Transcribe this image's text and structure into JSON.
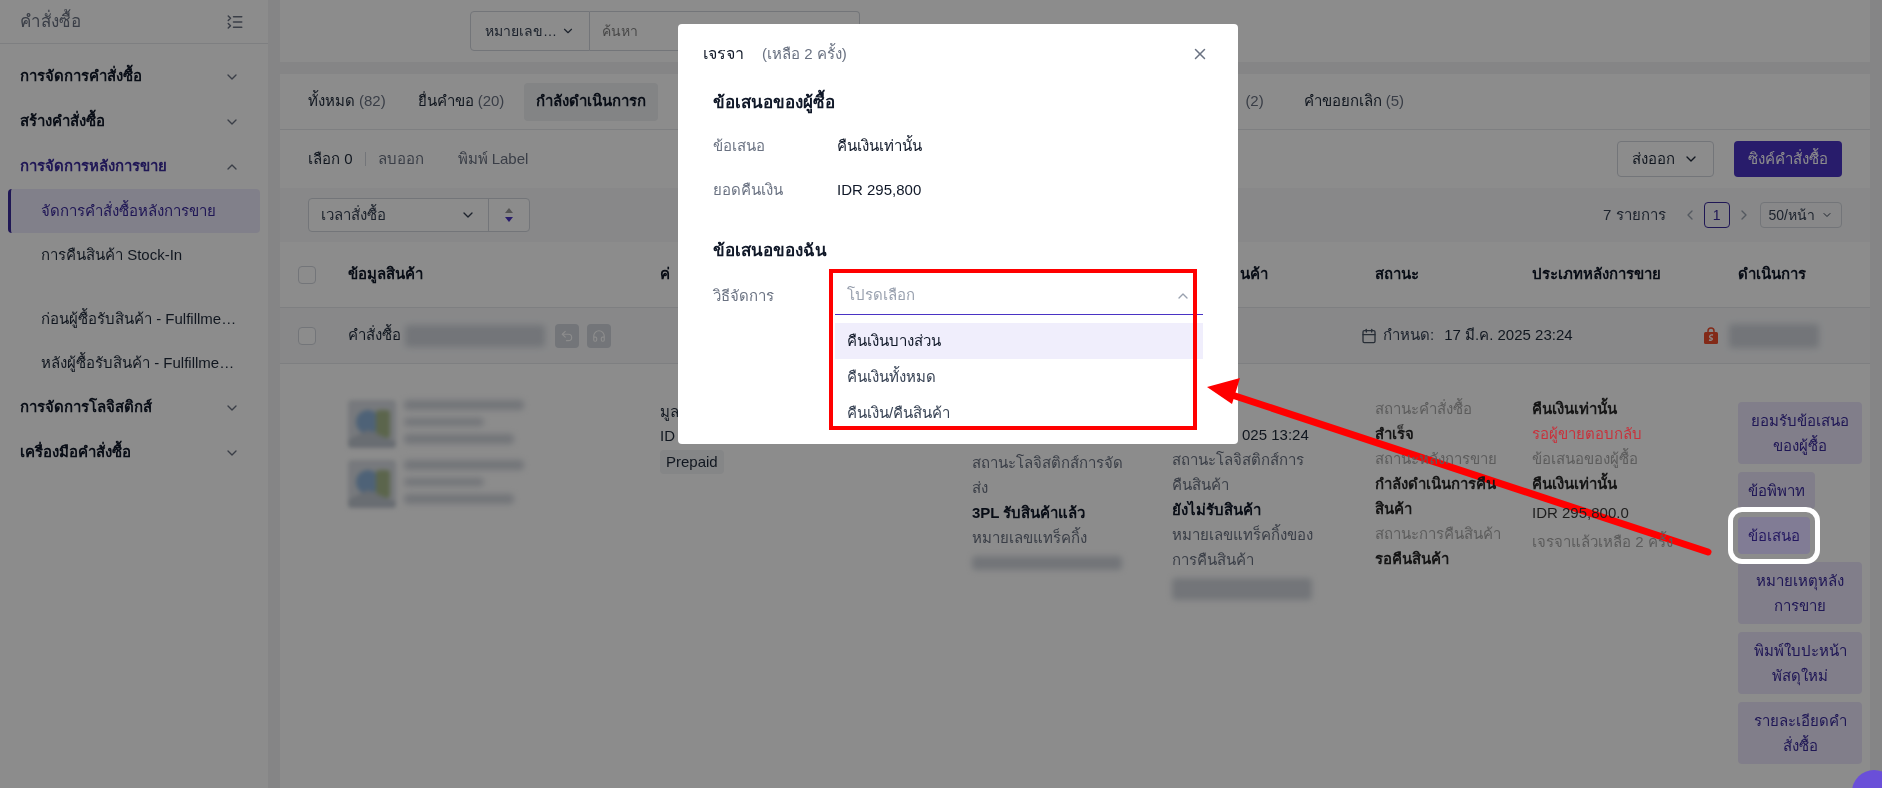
{
  "sidebar": {
    "title": "คำสั่งซื้อ",
    "items": [
      {
        "label": "การจัดการคำสั่งซื้อ",
        "expanded": false
      },
      {
        "label": "สร้างคำสั่งซื้อ",
        "expanded": false
      },
      {
        "label": "การจัดการหลังการขาย",
        "expanded": true,
        "children": [
          {
            "label": "จัดการคำสั่งซื้อหลังการขาย",
            "selected": true
          },
          {
            "label": "การคืนสินค้า Stock-In",
            "selected": false
          },
          {
            "label": "ก่อนผู้ซื้อรับสินค้า - Fulfillme…",
            "selected": false
          },
          {
            "label": "หลังผู้ซื้อรับสินค้า - Fulfillme…",
            "selected": false
          }
        ]
      },
      {
        "label": "การจัดการโลจิสติกส์",
        "expanded": false
      },
      {
        "label": "เครื่องมือคำสั่งซื้อ",
        "expanded": false
      }
    ]
  },
  "search": {
    "field": "หมายเลข…",
    "placeholder": "ค้นหา"
  },
  "tabs": [
    {
      "label": "ทั้งหมด",
      "count": "(82)",
      "selected": false
    },
    {
      "label": "ยื่นคำขอ",
      "count": "(20)",
      "selected": false
    },
    {
      "label": "กำลังดำเนินการก",
      "selected": true
    },
    {
      "count": "(2)",
      "selected": false
    },
    {
      "label": "คำขอยกเลิก",
      "count": "(5)",
      "selected": false
    }
  ],
  "toolbar": {
    "selection": "เลือก 0",
    "actions": [
      "ลบออก",
      "พิมพ์ Label"
    ],
    "export": "ส่งออก",
    "sync": "ซิงค์คำสั่งซื้อ"
  },
  "filter": {
    "sort_field": "เวลาสั่งซื้อ",
    "total": "7 รายการ",
    "page": "1",
    "page_size": "50/หน้า"
  },
  "table": {
    "select_all_checked": false,
    "columns": [
      "ข้อมูลสินค้า",
      "ค่",
      "นค้า",
      "สถานะ",
      "ประเภทหลังการขาย",
      "ดำเนินการ"
    ],
    "order": {
      "checked": false,
      "label": "คำสั่งซื้อ",
      "deadline_label": "กำหนด:",
      "deadline": "17 มี.ค. 2025 23:24"
    },
    "detail": {
      "payment_lines": [
        "มูล",
        "ID"
      ],
      "payment_tag": "Prepaid",
      "shipping": {
        "label": "สถานะโลจิสติกส์การจัดส่ง",
        "value": "3PL รับสินค้าแล้ว",
        "tracking_label": "หมายเลขแทร็คกิ้ง"
      },
      "return_shipping": {
        "time": "025 13:24",
        "label": "สถานะโลจิสติกส์การคืนสินค้า",
        "value": "ยังไม่รับสินค้า",
        "tracking_label": "หมายเลขแทร็คกิ้งของการคืนสินค้า"
      },
      "status": [
        {
          "label": "สถานะคำสั่งซื้อ",
          "value": "สำเร็จ"
        },
        {
          "label": "สถานะหลังการขาย",
          "value": "กำลังดำเนินการคืนสินค้า"
        },
        {
          "label": "สถานะการคืนสินค้า",
          "value": "รอคืนสินค้า"
        }
      ],
      "after_sales": {
        "type": "คืนเงินเท่านั้น",
        "state": "รอผู้ขายตอบกลับ",
        "offer_label": "ข้อเสนอของผู้ซื้อ",
        "offer": "คืนเงินเท่านั้น",
        "amount": "IDR 295,800.0",
        "remaining": "เจรจาแล้วเหลือ 2 ครั้ง"
      },
      "actions": [
        {
          "label": "ยอมรับข้อเสนอของผู้ซื้อ",
          "highlighted": false
        },
        {
          "label": "ข้อพิพาท",
          "highlighted": false
        },
        {
          "label": "ข้อเสนอ",
          "highlighted": true
        },
        {
          "label": "หมายเหตุหลังการขาย",
          "highlighted": false
        },
        {
          "label": "พิมพ์ใบปะหน้าพัสดุใหม่",
          "highlighted": false
        },
        {
          "label": "รายละเอียดคำสั่งซื้อ",
          "highlighted": false
        }
      ]
    }
  },
  "modal": {
    "title": "เจรจา",
    "subtitle": "(เหลือ 2 ครั้ง)",
    "buyer_offer": {
      "heading": "ข้อเสนอของผู้ซื้อ",
      "rows": [
        {
          "label": "ข้อเสนอ",
          "value": "คืนเงินเท่านั้น"
        },
        {
          "label": "ยอดคืนเงิน",
          "value": "IDR 295,800"
        }
      ]
    },
    "my_offer": {
      "heading": "ข้อเสนอของฉัน",
      "field_label": "วิธีจัดการ",
      "placeholder": "โปรดเลือก",
      "expanded": true,
      "annotated": true,
      "options": [
        {
          "label": "คืนเงินบางส่วน",
          "highlighted": true
        },
        {
          "label": "คืนเงินทั้งหมด",
          "highlighted": false
        },
        {
          "label": "คืนเงิน/คืนสินค้า",
          "highlighted": false
        }
      ]
    }
  }
}
